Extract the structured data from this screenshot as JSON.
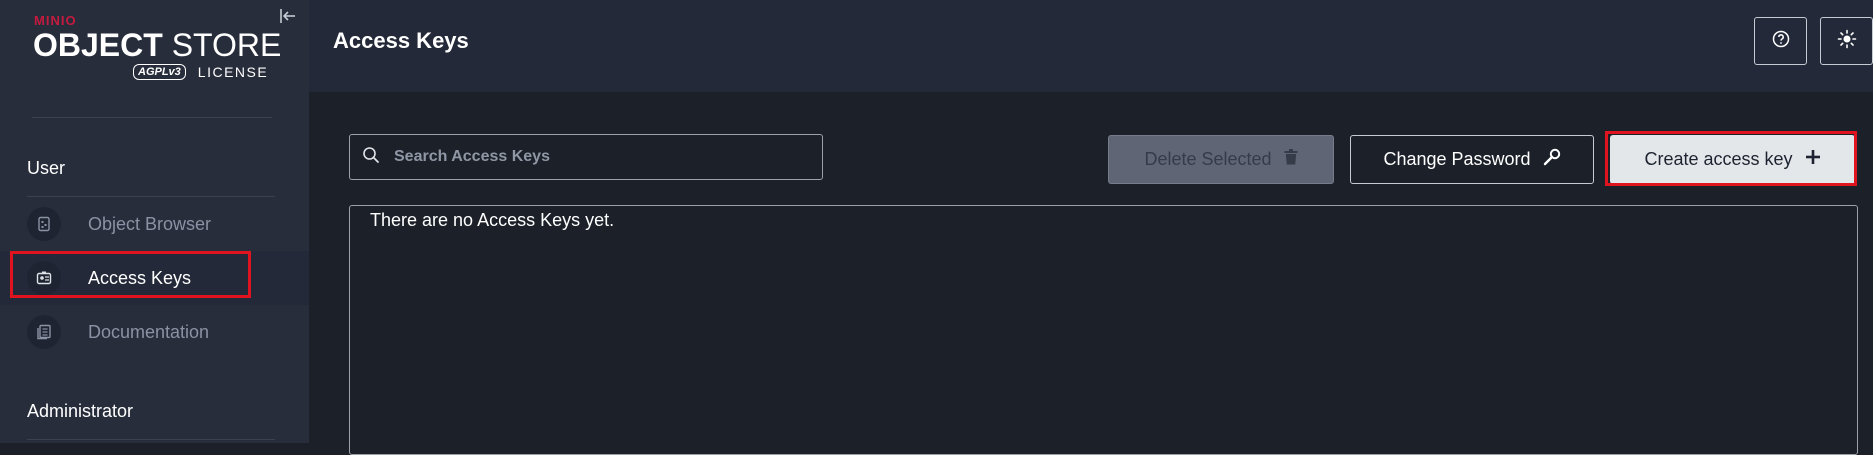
{
  "brand": {
    "name": "MINIO",
    "product_bold": "OBJECT",
    "product_rest": " STORE",
    "license_badge": "AGPLv3",
    "license_label": "LICENSE"
  },
  "sidebar": {
    "sections": [
      {
        "label": "User",
        "items": [
          {
            "label": "Object Browser",
            "icon": "object-browser-icon",
            "active": false
          },
          {
            "label": "Access Keys",
            "icon": "access-keys-icon",
            "active": true
          },
          {
            "label": "Documentation",
            "icon": "documentation-icon",
            "active": false
          }
        ]
      },
      {
        "label": "Administrator",
        "items": []
      }
    ]
  },
  "header": {
    "title": "Access Keys",
    "help_icon": "help-icon",
    "theme_icon": "sun-icon"
  },
  "main": {
    "search": {
      "placeholder": "Search Access Keys",
      "value": ""
    },
    "buttons": {
      "delete_label": "Delete Selected",
      "change_password_label": "Change Password",
      "create_label": "Create access key"
    },
    "empty_message": "There are no Access Keys yet."
  },
  "colors": {
    "sidebar_bg": "#272d3b",
    "header_bg": "#232938",
    "main_bg": "#1c2029",
    "brand_red": "#c51b3f",
    "highlight_red": "#e0141e"
  }
}
